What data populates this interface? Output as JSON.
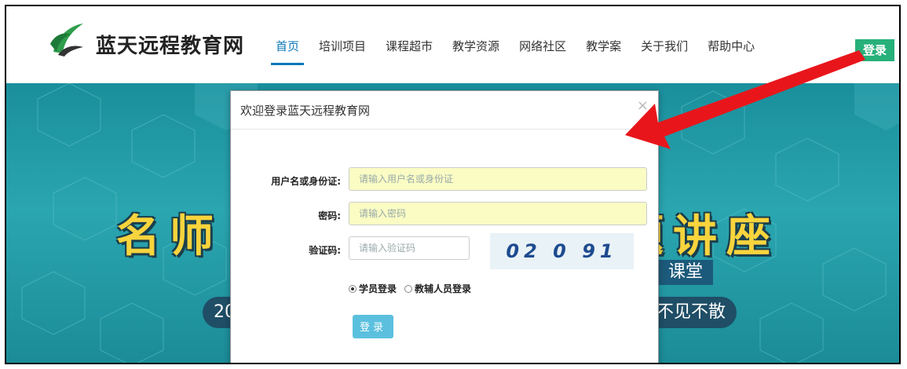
{
  "brand": {
    "name": "蓝天远程教育网"
  },
  "nav": {
    "items": [
      {
        "label": "首页"
      },
      {
        "label": "培训项目"
      },
      {
        "label": "课程超市"
      },
      {
        "label": "教学资源"
      },
      {
        "label": "网络社区"
      },
      {
        "label": "教学案"
      },
      {
        "label": "关于我们"
      },
      {
        "label": "帮助中心"
      }
    ],
    "login_label": "登录"
  },
  "hero": {
    "title": "名师",
    "title_right": "题讲座",
    "sub": "课堂",
    "tag_left": "20",
    "tag_right": "不见不散"
  },
  "modal": {
    "title": "欢迎登录蓝天远程教育网",
    "close": "×",
    "username_label": "用户名或身份证:",
    "username_placeholder": "请输入用户名或身份证",
    "password_label": "密码:",
    "password_placeholder": "请输入密码",
    "captcha_label": "验证码:",
    "captcha_placeholder": "请输入验证码",
    "captcha_text": "02 0 91",
    "role_student": "学员登录",
    "role_staff": "教辅人员登录",
    "submit_label": "登录"
  },
  "colors": {
    "accent": "#0a78b8",
    "login_green": "#27b07a",
    "hero_teal": "#2aa6b1",
    "arrow_red": "#e8161b"
  }
}
